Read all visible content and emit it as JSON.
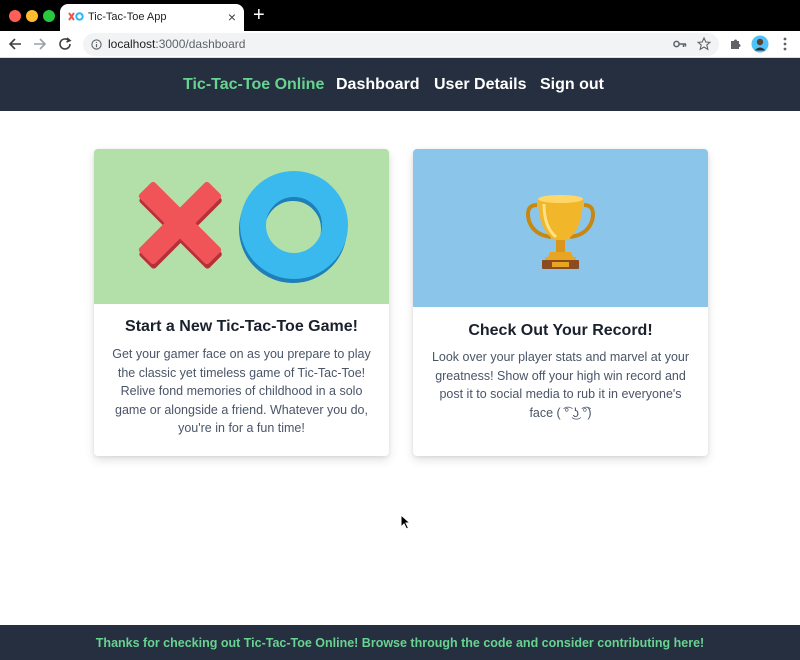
{
  "browser": {
    "tab_title": "Tic-Tac-Toe App",
    "tab_close": "×",
    "new_tab": "+",
    "url_host": "localhost",
    "url_path": ":3000/dashboard"
  },
  "header": {
    "brand": "Tic-Tac-Toe Online",
    "nav": {
      "dashboard": "Dashboard",
      "user_details": "User Details",
      "sign_out": "Sign out"
    }
  },
  "cards": [
    {
      "title": "Start a New Tic-Tac-Toe Game!",
      "text": "Get your gamer face on as you prepare to play the classic yet timeless game of Tic-Tac-Toe! Relive fond memories of childhood in a solo game or alongside a friend. Whatever you do, you're in for a fun time!",
      "image": "x-and-o-illustration",
      "image_bg": "#b3e0a9"
    },
    {
      "title": "Check Out Your Record!",
      "text": "Look over your player stats and marvel at your greatness! Show off your high win record and post it to social media to rub it in everyone's face ( ͡° ͜ʖ ͡°)",
      "image": "trophy-icon",
      "image_bg": "#8bc6ea"
    }
  ],
  "footer": {
    "text": "Thanks for checking out Tic-Tac-Toe Online! Browse through the code and consider contributing here!"
  },
  "colors": {
    "header_bg": "#252f3f",
    "brand_green": "#68d391",
    "card_green": "#b3e0a9",
    "card_blue": "#8bc6ea"
  }
}
